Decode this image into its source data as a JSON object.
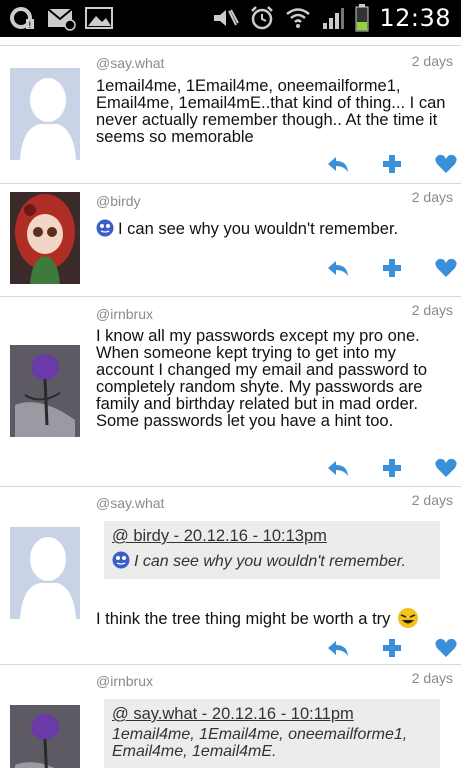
{
  "status_bar": {
    "time": "12:38",
    "icons": [
      "sync-icon",
      "mail-icon",
      "gallery-icon",
      "mute-icon",
      "alarm-icon",
      "wifi-icon",
      "signal-icon",
      "battery-icon"
    ]
  },
  "posts": [
    {
      "handle": "@say.what",
      "date": "2 days",
      "avatar": "default-avatar",
      "text": "1email4me, 1Email4me, oneemailforme1, Email4me, 1email4mE..that kind of thing... I can never actually remember though.. At the time it seems so memorable"
    },
    {
      "handle": "@birdy",
      "date": "2 days",
      "avatar": "doll-avatar",
      "text": "I can see why you wouldn't remember."
    },
    {
      "handle": "@irnbrux",
      "date": "2 days",
      "avatar": "rose-avatar",
      "text": "I know all my passwords except my pro one. When someone kept trying to get into my account I changed my email and password to completely random shyte. My passwords are family and birthday related but in mad order. Some passwords let you have a hint too."
    },
    {
      "handle": "@say.what",
      "date": "2 days",
      "avatar": "default-avatar",
      "quote": {
        "head": "@ birdy - 20.12.16 - 10:13pm",
        "text": "I can see why you wouldn't remember."
      },
      "text": "I think the tree thing might be worth a try"
    },
    {
      "handle": "@irnbrux",
      "date": "2 days",
      "avatar": "rose-avatar",
      "quote": {
        "head": "@ say.what - 20.12.16 - 10:11pm",
        "text": "1email4me, 1Email4me, oneemailforme1, Email4me, 1email4mE."
      }
    }
  ],
  "colors": {
    "accent": "#3a8fd8",
    "handle": "#8a8a8a",
    "quote_bg": "#ececec",
    "battery": "#8fd43a"
  }
}
